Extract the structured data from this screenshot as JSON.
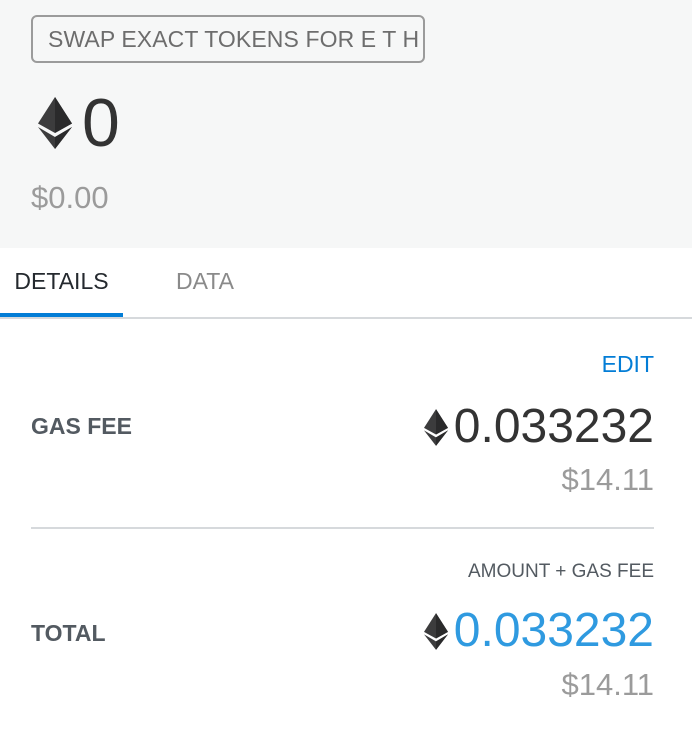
{
  "header": {
    "method": "SWAP EXACT TOKENS FOR E T H",
    "amount": "0",
    "fiat": "$0.00",
    "icon": "eth-icon"
  },
  "tabs": [
    {
      "label": "DETAILS",
      "active": true
    },
    {
      "label": "DATA",
      "active": false
    }
  ],
  "details": {
    "edit_label": "EDIT",
    "gas_fee": {
      "label": "GAS FEE",
      "amount": "0.033232",
      "fiat": "$14.11"
    },
    "total": {
      "heading": "AMOUNT + GAS FEE",
      "label": "TOTAL",
      "amount": "0.033232",
      "fiat": "$14.11"
    }
  },
  "colors": {
    "accent": "#037dd6",
    "total_amount": "#2f9ae0",
    "muted": "#9b9b9b",
    "header_bg": "#f6f7f7"
  }
}
